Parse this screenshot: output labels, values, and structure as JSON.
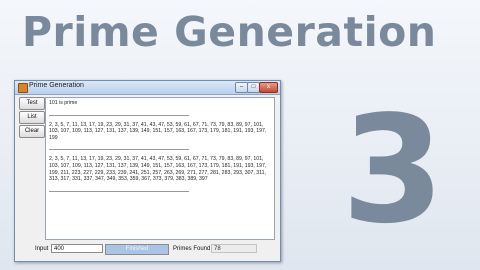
{
  "banner": {
    "title": "Prime Generation",
    "number": "3"
  },
  "window": {
    "title": "Prime Generation",
    "controls": {
      "minimize": "–",
      "maximize": "□",
      "close": "x"
    }
  },
  "sidebar": {
    "test": "Test",
    "list": "List",
    "clear": "Clear"
  },
  "output": {
    "line1": "101 is prime",
    "list1": "2, 3, 5, 7, 11, 13, 17, 19, 23, 29, 31, 37, 41, 43, 47, 53, 59, 61, 67, 71, 73, 79, 83, 89, 97, 101, 103, 107, 109, 113, 127, 131, 137, 139, 149, 151, 157, 163, 167, 173, 179, 181, 191, 193, 197, 199",
    "list2": "2, 3, 5, 7, 11, 13, 17, 19, 23, 29, 31, 37, 41, 43, 47, 53, 59, 61, 67, 71, 73, 79, 83, 89, 97, 101, 103, 107, 109, 113, 127, 131, 137, 139, 149, 151, 157, 163, 167, 173, 179, 181, 191, 193, 197, 199, 211, 223, 227, 229, 233, 239, 241, 251, 257, 263, 269, 271, 277, 281, 283, 293, 307, 311, 313, 317, 331, 337, 347, 349, 353, 359, 367, 373, 379, 383, 389, 397"
  },
  "bottom": {
    "input_label": "Input",
    "input_value": "400",
    "progress_text": "Finished",
    "progress_value": 1.0,
    "found_label": "Primes Found",
    "found_value": "78"
  }
}
